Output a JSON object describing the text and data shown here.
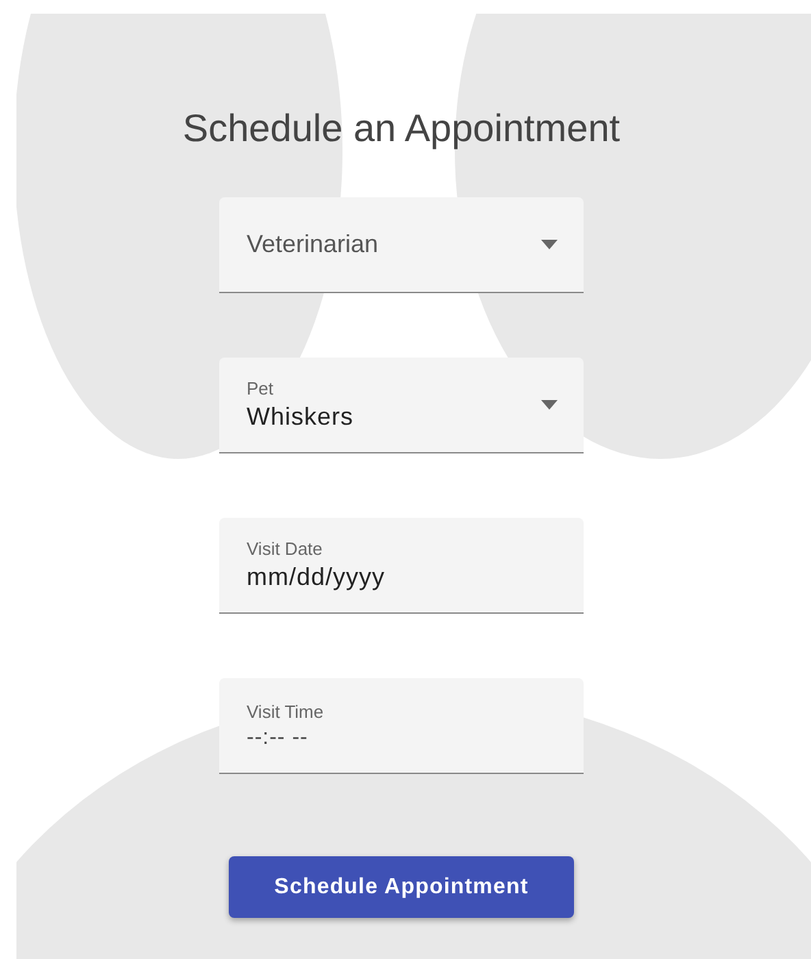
{
  "title": "Schedule an Appointment",
  "fields": [
    {
      "kind": "select",
      "label": "Veterinarian"
    },
    {
      "kind": "select",
      "label": "Pet",
      "value": "Whiskers"
    },
    {
      "kind": "date",
      "label": "Visit Date",
      "value": "mm/dd/yyyy"
    },
    {
      "kind": "time",
      "label": "Visit Time",
      "value": "--:-- --"
    }
  ],
  "button": {
    "label": "Schedule Appointment"
  }
}
